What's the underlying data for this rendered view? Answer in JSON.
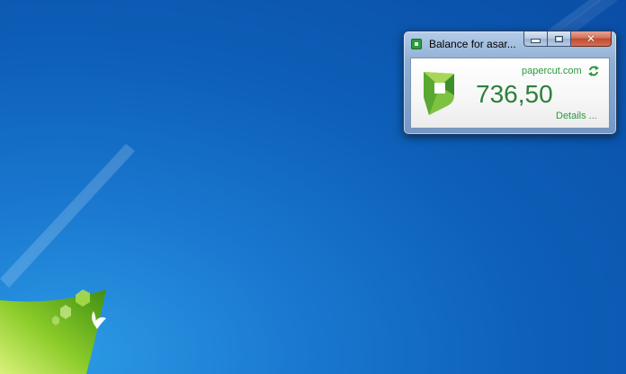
{
  "window": {
    "title": "Balance for asar...",
    "close_glyph": "✕"
  },
  "widget": {
    "site_link": "papercut.com",
    "balance": "736,50",
    "details_link": "Details ..."
  },
  "icons": {
    "app": "papercut-icon",
    "logo": "papercut-logo",
    "refresh": "refresh-icon"
  },
  "colors": {
    "accent_green": "#2c9a3e",
    "balance_green": "#2d7f3b",
    "close_red": "#c04a30",
    "desktop_blue": "#0d5fb8"
  }
}
